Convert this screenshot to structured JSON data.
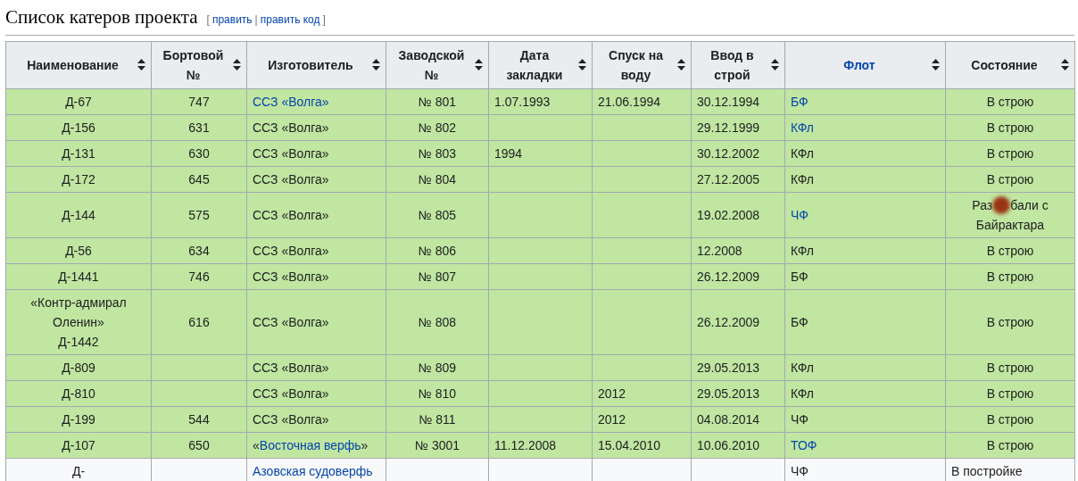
{
  "heading": {
    "title": "Список катеров проекта",
    "edit_links": [
      "править",
      "править код"
    ],
    "brackets": [
      "[",
      "|",
      "]"
    ]
  },
  "table": {
    "columns": [
      {
        "label": [
          "Наименование"
        ],
        "link": false
      },
      {
        "label": [
          "Бортовой",
          "№"
        ],
        "link": false
      },
      {
        "label": [
          "Изготовитель"
        ],
        "link": false
      },
      {
        "label": [
          "Заводской",
          "№"
        ],
        "link": false
      },
      {
        "label": [
          "Дата",
          "закладки"
        ],
        "link": false
      },
      {
        "label": [
          "Спуск на",
          "воду"
        ],
        "link": false
      },
      {
        "label": [
          "Ввод в",
          "строй"
        ],
        "link": false
      },
      {
        "label": [
          "Флот"
        ],
        "link": true
      },
      {
        "label": [
          "Состояние"
        ],
        "link": false
      }
    ],
    "rows": [
      {
        "kind": "active",
        "name": [
          "Д-67"
        ],
        "board": "747",
        "maker": [
          {
            "text": "ССЗ «Волга»",
            "link": true
          }
        ],
        "factory": "№ 801",
        "laid": "1.07.1993",
        "launched": "21.06.1994",
        "commissioned": "30.12.1994",
        "fleet": "БФ",
        "fleet_link": true,
        "status": [
          "В строю"
        ]
      },
      {
        "kind": "active",
        "name": [
          "Д-156"
        ],
        "board": "631",
        "maker": [
          {
            "text": "ССЗ «Волга»",
            "link": false
          }
        ],
        "factory": "№ 802",
        "laid": "",
        "launched": "",
        "commissioned": "29.12.1999",
        "fleet": "КФл",
        "fleet_link": true,
        "status": [
          "В строю"
        ]
      },
      {
        "kind": "active",
        "name": [
          "Д-131"
        ],
        "board": "630",
        "maker": [
          {
            "text": "ССЗ «Волга»",
            "link": false
          }
        ],
        "factory": "№ 803",
        "laid": "1994",
        "launched": "",
        "commissioned": "30.12.2002",
        "fleet": "КФл",
        "fleet_link": false,
        "status": [
          "В строю"
        ]
      },
      {
        "kind": "active",
        "name": [
          "Д-172"
        ],
        "board": "645",
        "maker": [
          {
            "text": "ССЗ «Волга»",
            "link": false
          }
        ],
        "factory": "№ 804",
        "laid": "",
        "launched": "",
        "commissioned": "27.12.2005",
        "fleet": "КФл",
        "fleet_link": false,
        "status": [
          "В строю"
        ]
      },
      {
        "kind": "active",
        "name": [
          "Д-144"
        ],
        "board": "575",
        "maker": [
          {
            "text": "ССЗ «Волга»",
            "link": false
          }
        ],
        "factory": "№ 805",
        "laid": "",
        "launched": "",
        "commissioned": "19.02.2008",
        "fleet": "ЧФ",
        "fleet_link": true,
        "status": [
          "Раз",
          "бали с",
          "Байрактара"
        ]
      },
      {
        "kind": "active",
        "name": [
          "Д-56"
        ],
        "board": "634",
        "maker": [
          {
            "text": "ССЗ «Волга»",
            "link": false
          }
        ],
        "factory": "№ 806",
        "laid": "",
        "launched": "",
        "commissioned": "12.2008",
        "fleet": "КФл",
        "fleet_link": false,
        "status": [
          "В строю"
        ]
      },
      {
        "kind": "active",
        "name": [
          "Д-1441"
        ],
        "board": "746",
        "maker": [
          {
            "text": "ССЗ «Волга»",
            "link": false
          }
        ],
        "factory": "№ 807",
        "laid": "",
        "launched": "",
        "commissioned": "26.12.2009",
        "fleet": "БФ",
        "fleet_link": false,
        "status": [
          "В строю"
        ]
      },
      {
        "kind": "active",
        "name": [
          "«Контр-адмирал Оленин»",
          "Д-1442"
        ],
        "board": "616",
        "maker": [
          {
            "text": "ССЗ «Волга»",
            "link": false
          }
        ],
        "factory": "№ 808",
        "laid": "",
        "launched": "",
        "commissioned": "26.12.2009",
        "fleet": "БФ",
        "fleet_link": false,
        "status": [
          "В строю"
        ]
      },
      {
        "kind": "active",
        "name": [
          "Д-809"
        ],
        "board": "",
        "maker": [
          {
            "text": "ССЗ «Волга»",
            "link": false
          }
        ],
        "factory": "№ 809",
        "laid": "",
        "launched": "",
        "commissioned": "29.05.2013",
        "fleet": "КФл",
        "fleet_link": false,
        "status": [
          "В строю"
        ]
      },
      {
        "kind": "active",
        "name": [
          "Д-810"
        ],
        "board": "",
        "maker": [
          {
            "text": "ССЗ «Волга»",
            "link": false
          }
        ],
        "factory": "№ 810",
        "laid": "",
        "launched": "2012",
        "commissioned": "29.05.2013",
        "fleet": "КФл",
        "fleet_link": false,
        "status": [
          "В строю"
        ]
      },
      {
        "kind": "active",
        "name": [
          "Д-199"
        ],
        "board": "544",
        "maker": [
          {
            "text": "ССЗ «Волга»",
            "link": false
          }
        ],
        "factory": "№ 811",
        "laid": "",
        "launched": "2012",
        "commissioned": "04.08.2014",
        "fleet": "ЧФ",
        "fleet_link": false,
        "status": [
          "В строю"
        ]
      },
      {
        "kind": "active",
        "name": [
          "Д-107"
        ],
        "board": "650",
        "maker": [
          {
            "text": "«",
            "link": false
          },
          {
            "text": "Восточная верфь",
            "link": true
          },
          {
            "text": "»",
            "link": false
          }
        ],
        "factory": "№ 3001",
        "laid": "11.12.2008",
        "launched": "15.04.2010",
        "commissioned": "10.06.2010",
        "fleet": "ТОФ",
        "fleet_link": true,
        "status": [
          "В строю"
        ]
      },
      {
        "kind": "building",
        "name": [
          "Д-"
        ],
        "board": "",
        "maker": [
          {
            "text": "Азовская судоверфь",
            "link": true
          }
        ],
        "factory": "",
        "laid": "",
        "launched": "",
        "commissioned": "",
        "fleet": "ЧФ",
        "fleet_link": false,
        "status": [
          "В постройке"
        ]
      }
    ]
  }
}
